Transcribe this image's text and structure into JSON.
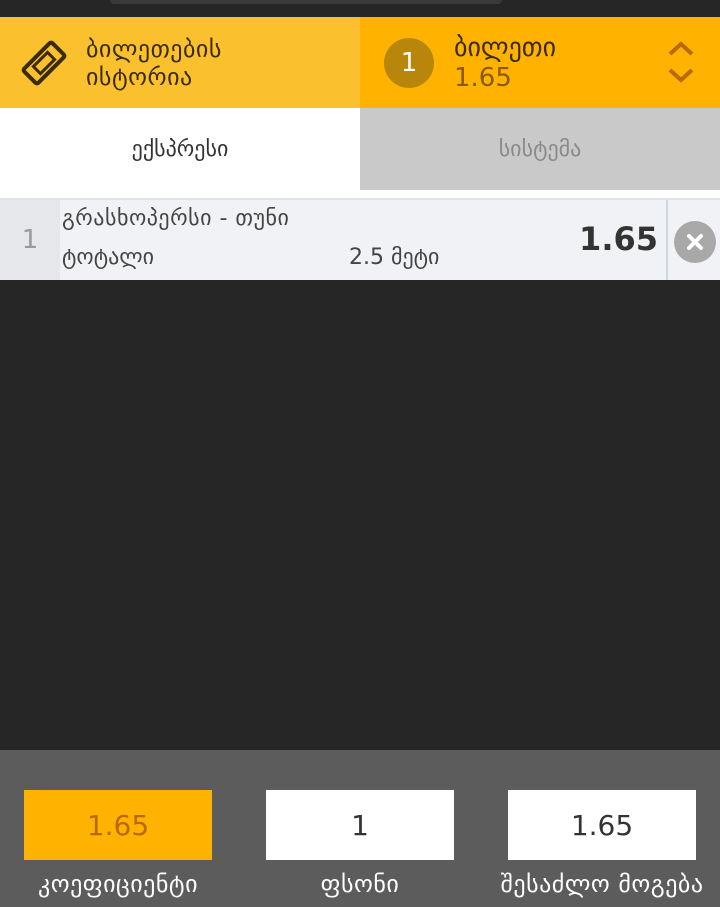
{
  "header": {
    "history_label_line1": "ბილეთების",
    "history_label_line2": "ისტორია",
    "bet_count": "1",
    "bet_title": "ბილეთი",
    "bet_odds": "1.65"
  },
  "tabs": [
    {
      "label": "ექსპრესი",
      "active": true
    },
    {
      "label": "სისტემა",
      "active": false
    }
  ],
  "bets": [
    {
      "index": "1",
      "match": "გრასხოპერსი - თუნი",
      "market": "ტოტალი",
      "selection": "2.5 მეტი",
      "odds": "1.65"
    }
  ],
  "footer": {
    "coefficient_value": "1.65",
    "coefficient_label": "კოეფიციენტი",
    "stake_value": "1",
    "stake_label": "ფსონი",
    "possible_win_value": "1.65",
    "possible_win_label": "შესაძლო მოგება"
  },
  "colors": {
    "accent": "#ffb300",
    "accent_light": "#fbc02d",
    "badge": "#b8860b",
    "background": "#262626",
    "footer": "#5c5c5c"
  },
  "icons": {
    "history": "ticket-icon",
    "toggle": "chevron-up-down-icon",
    "remove": "close-icon"
  }
}
